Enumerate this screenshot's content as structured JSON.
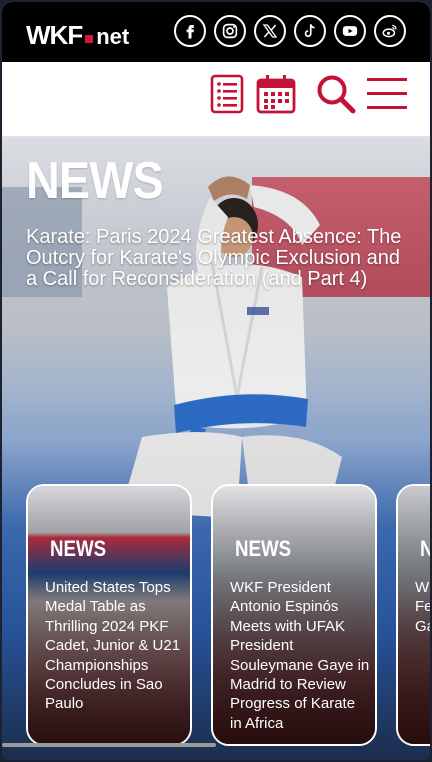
{
  "header": {
    "logo": {
      "brand": "WKF",
      "suffix": "net"
    },
    "social": [
      {
        "icon": "facebook-icon"
      },
      {
        "icon": "instagram-icon"
      },
      {
        "icon": "x-icon"
      },
      {
        "icon": "tiktok-icon"
      },
      {
        "icon": "youtube-icon"
      },
      {
        "icon": "weibo-icon"
      }
    ]
  },
  "nav": {
    "icons": [
      "list-icon",
      "calendar-icon",
      "search-icon",
      "menu-icon"
    ],
    "accent": "#c41236"
  },
  "hero": {
    "tag": "NEWS",
    "title": "Karate: Paris 2024 Greatest Absence: The Outcry for Karate's Olympic Exclusion and a Call for Reconsideration (and Part 4)"
  },
  "cards": [
    {
      "tag": "NEWS",
      "title": "United States Tops Medal Table as Thrilling 2024 PKF Cadet, Junior & U21 Championships Concludes in Sao Paulo"
    },
    {
      "tag": "NEWS",
      "title": "WKF President Antonio Espinós Meets with UFAK President Souleymane Gaye in Madrid to Review Progress of Karate in Africa"
    },
    {
      "tag": "N",
      "title": "W… Ar… Me… Sc… Fe… Di… Ro… Ga…"
    }
  ]
}
